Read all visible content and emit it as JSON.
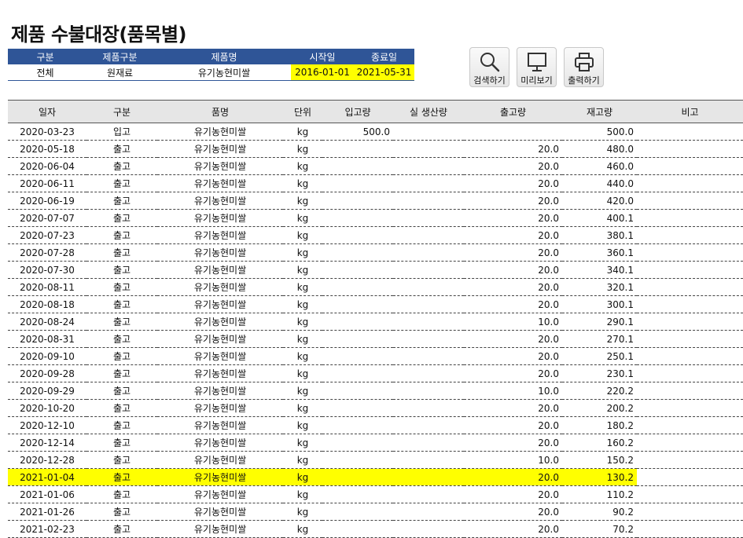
{
  "page_title": "제품 수불대장(품목별)",
  "filter": {
    "headers": [
      "구분",
      "제품구분",
      "제품명",
      "시작일",
      "종료일"
    ],
    "values": [
      "전체",
      "원재료",
      "유기농현미쌀",
      "2016-01-01",
      "2021-05-31"
    ]
  },
  "buttons": {
    "search": "검색하기",
    "preview": "미리보기",
    "print": "출력하기"
  },
  "colors": {
    "header_blue": "#2f5597",
    "highlight": "#ffff00",
    "grid_header": "#e6e6e6"
  },
  "columns": [
    "일자",
    "구분",
    "품명",
    "단위",
    "입고량",
    "실 생산량",
    "출고량",
    "재고량",
    "비고"
  ],
  "rows": [
    {
      "date": "2020-03-23",
      "type": "입고",
      "item": "유기농현미쌀",
      "unit": "kg",
      "in": "500.0",
      "prod": "",
      "out": "",
      "stock": "500.0",
      "note": ""
    },
    {
      "date": "2020-05-18",
      "type": "출고",
      "item": "유기농현미쌀",
      "unit": "kg",
      "in": "",
      "prod": "",
      "out": "20.0",
      "stock": "480.0",
      "note": ""
    },
    {
      "date": "2020-06-04",
      "type": "출고",
      "item": "유기농현미쌀",
      "unit": "kg",
      "in": "",
      "prod": "",
      "out": "20.0",
      "stock": "460.0",
      "note": ""
    },
    {
      "date": "2020-06-11",
      "type": "출고",
      "item": "유기농현미쌀",
      "unit": "kg",
      "in": "",
      "prod": "",
      "out": "20.0",
      "stock": "440.0",
      "note": ""
    },
    {
      "date": "2020-06-19",
      "type": "출고",
      "item": "유기농현미쌀",
      "unit": "kg",
      "in": "",
      "prod": "",
      "out": "20.0",
      "stock": "420.0",
      "note": ""
    },
    {
      "date": "2020-07-07",
      "type": "출고",
      "item": "유기농현미쌀",
      "unit": "kg",
      "in": "",
      "prod": "",
      "out": "20.0",
      "stock": "400.1",
      "note": ""
    },
    {
      "date": "2020-07-23",
      "type": "출고",
      "item": "유기농현미쌀",
      "unit": "kg",
      "in": "",
      "prod": "",
      "out": "20.0",
      "stock": "380.1",
      "note": ""
    },
    {
      "date": "2020-07-28",
      "type": "출고",
      "item": "유기농현미쌀",
      "unit": "kg",
      "in": "",
      "prod": "",
      "out": "20.0",
      "stock": "360.1",
      "note": ""
    },
    {
      "date": "2020-07-30",
      "type": "출고",
      "item": "유기농현미쌀",
      "unit": "kg",
      "in": "",
      "prod": "",
      "out": "20.0",
      "stock": "340.1",
      "note": ""
    },
    {
      "date": "2020-08-11",
      "type": "출고",
      "item": "유기농현미쌀",
      "unit": "kg",
      "in": "",
      "prod": "",
      "out": "20.0",
      "stock": "320.1",
      "note": ""
    },
    {
      "date": "2020-08-18",
      "type": "출고",
      "item": "유기농현미쌀",
      "unit": "kg",
      "in": "",
      "prod": "",
      "out": "20.0",
      "stock": "300.1",
      "note": ""
    },
    {
      "date": "2020-08-24",
      "type": "출고",
      "item": "유기농현미쌀",
      "unit": "kg",
      "in": "",
      "prod": "",
      "out": "10.0",
      "stock": "290.1",
      "note": ""
    },
    {
      "date": "2020-08-31",
      "type": "출고",
      "item": "유기농현미쌀",
      "unit": "kg",
      "in": "",
      "prod": "",
      "out": "20.0",
      "stock": "270.1",
      "note": ""
    },
    {
      "date": "2020-09-10",
      "type": "출고",
      "item": "유기농현미쌀",
      "unit": "kg",
      "in": "",
      "prod": "",
      "out": "20.0",
      "stock": "250.1",
      "note": ""
    },
    {
      "date": "2020-09-28",
      "type": "출고",
      "item": "유기농현미쌀",
      "unit": "kg",
      "in": "",
      "prod": "",
      "out": "20.0",
      "stock": "230.1",
      "note": ""
    },
    {
      "date": "2020-09-29",
      "type": "출고",
      "item": "유기농현미쌀",
      "unit": "kg",
      "in": "",
      "prod": "",
      "out": "10.0",
      "stock": "220.2",
      "note": ""
    },
    {
      "date": "2020-10-20",
      "type": "출고",
      "item": "유기농현미쌀",
      "unit": "kg",
      "in": "",
      "prod": "",
      "out": "20.0",
      "stock": "200.2",
      "note": ""
    },
    {
      "date": "2020-12-10",
      "type": "출고",
      "item": "유기농현미쌀",
      "unit": "kg",
      "in": "",
      "prod": "",
      "out": "20.0",
      "stock": "180.2",
      "note": ""
    },
    {
      "date": "2020-12-14",
      "type": "출고",
      "item": "유기농현미쌀",
      "unit": "kg",
      "in": "",
      "prod": "",
      "out": "20.0",
      "stock": "160.2",
      "note": ""
    },
    {
      "date": "2020-12-28",
      "type": "출고",
      "item": "유기농현미쌀",
      "unit": "kg",
      "in": "",
      "prod": "",
      "out": "10.0",
      "stock": "150.2",
      "note": ""
    },
    {
      "date": "2021-01-04",
      "type": "출고",
      "item": "유기농현미쌀",
      "unit": "kg",
      "in": "",
      "prod": "",
      "out": "20.0",
      "stock": "130.2",
      "note": "",
      "highlight": true
    },
    {
      "date": "2021-01-06",
      "type": "출고",
      "item": "유기농현미쌀",
      "unit": "kg",
      "in": "",
      "prod": "",
      "out": "20.0",
      "stock": "110.2",
      "note": ""
    },
    {
      "date": "2021-01-26",
      "type": "출고",
      "item": "유기농현미쌀",
      "unit": "kg",
      "in": "",
      "prod": "",
      "out": "20.0",
      "stock": "90.2",
      "note": ""
    },
    {
      "date": "2021-02-23",
      "type": "출고",
      "item": "유기농현미쌀",
      "unit": "kg",
      "in": "",
      "prod": "",
      "out": "20.0",
      "stock": "70.2",
      "note": ""
    }
  ]
}
